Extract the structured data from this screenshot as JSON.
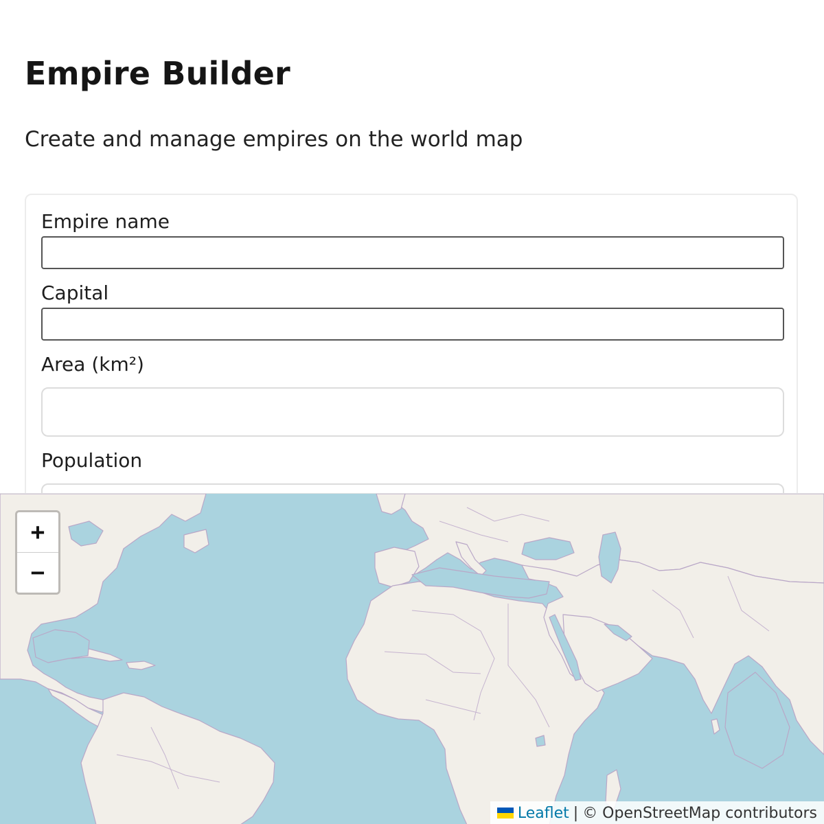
{
  "header": {
    "title": "Empire Builder",
    "subtitle": "Create and manage empires on the world map"
  },
  "form": {
    "empire_name_label": "Empire name",
    "empire_name_value": "",
    "capital_label": "Capital",
    "capital_value": "",
    "area_label": "Area (km²)",
    "area_value": "",
    "population_label": "Population",
    "population_value": ""
  },
  "map": {
    "zoom_in_label": "+",
    "zoom_out_label": "−",
    "attribution_leaflet": "Leaflet",
    "attribution_separator": "|",
    "attribution_osm": "© OpenStreetMap contributors",
    "colors": {
      "water": "#aad3df",
      "land": "#f2efe9",
      "border": "#b9a7c7"
    }
  }
}
